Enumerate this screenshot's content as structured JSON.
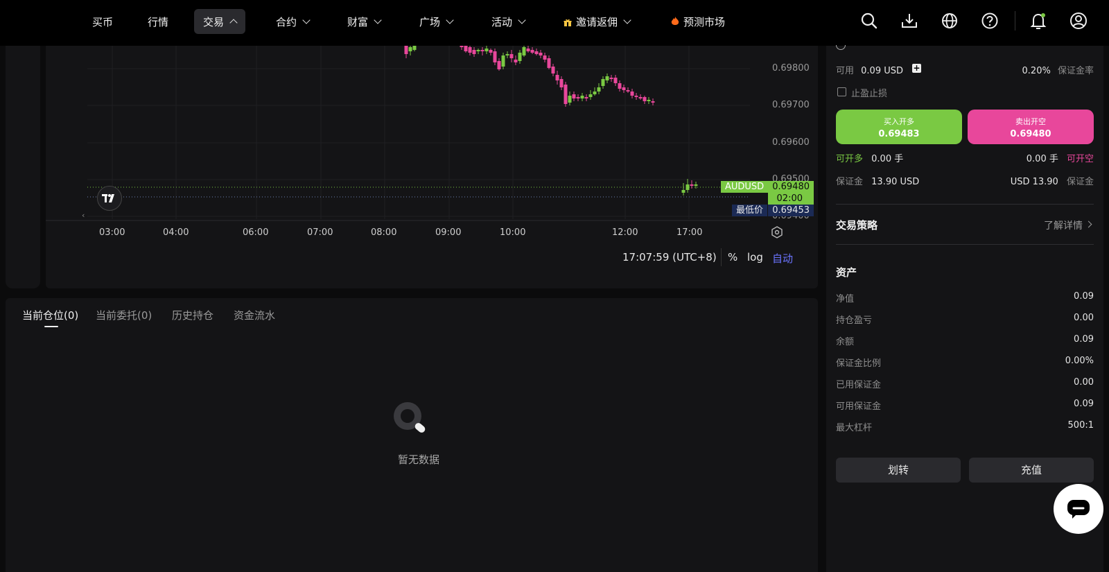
{
  "nav": {
    "items": [
      "买币",
      "行情",
      "交易",
      "合约",
      "财富",
      "广场",
      "活动",
      "邀请返佣",
      "预测市场"
    ]
  },
  "chart": {
    "symbol": "AUDUSD",
    "last_price": "0.69480",
    "countdown": "02:00",
    "low_label": "最低价",
    "low_price": "0.69453",
    "y_ticks": [
      "0.69800",
      "0.69700",
      "0.69600",
      "0.69500",
      "0.69400"
    ],
    "x_ticks": [
      "03:00",
      "04:00",
      "06:00",
      "07:00",
      "08:00",
      "09:00",
      "10:00",
      "12:00",
      "17:00"
    ],
    "time": "17:07:59 (UTC+8)",
    "percent": "%",
    "log": "log",
    "auto": "自动",
    "colors": {
      "up": "#7ac943",
      "down": "#e8479b",
      "accent": "#6b74ff"
    }
  },
  "tabs": [
    "当前仓位(0)",
    "当前委托(0)",
    "历史持仓",
    "资金流水"
  ],
  "empty_text": "暂无数据",
  "order": {
    "available_label": "可用",
    "available_value": "0.09 USD",
    "margin_rate_value": "0.20%",
    "margin_rate_label": "保证金率",
    "tpsl_label": "止盈止损",
    "buy_label": "买入开多",
    "buy_price": "0.69483",
    "sell_label": "卖出开空",
    "sell_price": "0.69480",
    "can_long_label": "可开多",
    "can_long_value": "0.00 手",
    "can_short_value": "0.00 手",
    "can_short_label": "可开空",
    "margin_label": "保证金",
    "margin_left_value": "13.90 USD",
    "margin_right_value": "USD 13.90",
    "margin_right_label": "保证金"
  },
  "strategy": {
    "title": "交易策略",
    "link": "了解详情"
  },
  "assets": {
    "title": "资产",
    "rows": [
      {
        "label": "净值",
        "value": "0.09"
      },
      {
        "label": "持仓盈亏",
        "value": "0.00"
      },
      {
        "label": "余额",
        "value": "0.09"
      },
      {
        "label": "保证金比例",
        "value": "0.00%"
      },
      {
        "label": "已用保证金",
        "value": "0.00"
      },
      {
        "label": "可用保证金",
        "value": "0.09"
      },
      {
        "label": "最大杠杆",
        "value": "500:1"
      }
    ]
  },
  "buttons": {
    "transfer": "划转",
    "deposit": "充值"
  }
}
